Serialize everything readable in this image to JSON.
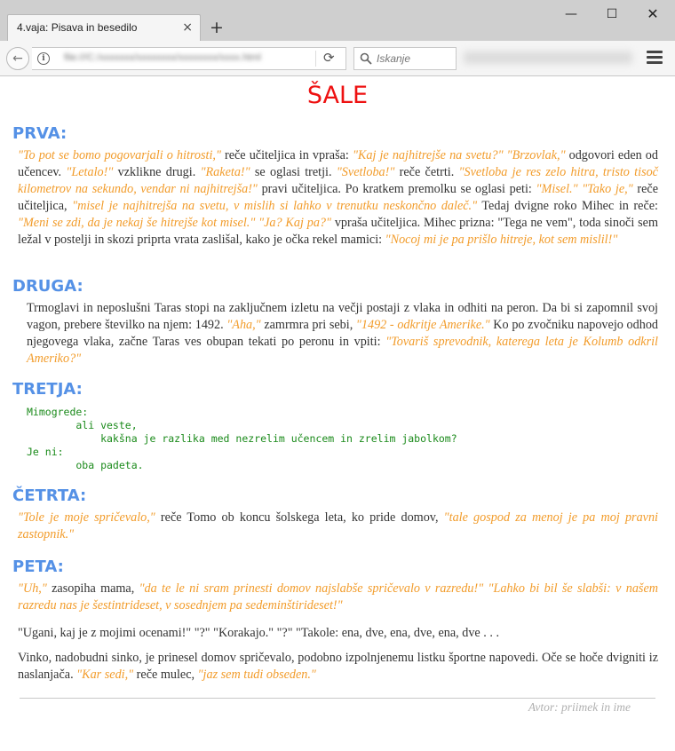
{
  "browser": {
    "tab_title": "4.vaja: Pisava in besedilo",
    "tab_close": "×",
    "new_tab": "+",
    "search_placeholder": "Iskanje",
    "window_controls": {
      "minimize": "—",
      "maximize": "☐",
      "close": "✕"
    },
    "icons": [
      "back-icon",
      "info-icon",
      "reload-icon",
      "search-icon",
      "menu-icon"
    ]
  },
  "page": {
    "title": "ŠALE",
    "sections": [
      {
        "heading": "PRVA:",
        "paragraph": [
          [
            "q",
            "\"To pot se bomo pogovarjali o hitrosti,\""
          ],
          [
            "t",
            " reče učiteljica in vpraša: "
          ],
          [
            "q",
            "\"Kaj je najhitrejše na svetu?\" \"Brzovlak,\""
          ],
          [
            "t",
            " odgovori eden od učencev. "
          ],
          [
            "q",
            "\"Letalo!\""
          ],
          [
            "t",
            " vzklikne drugi. "
          ],
          [
            "q",
            "\"Raketa!\""
          ],
          [
            "t",
            " se oglasi tretji. "
          ],
          [
            "q",
            "\"Svetloba!\""
          ],
          [
            "t",
            " reče četrti. "
          ],
          [
            "q",
            "\"Svetloba je res zelo hitra, tristo tisoč kilometrov na sekundo, vendar ni najhitrejša!\""
          ],
          [
            "t",
            " pravi učiteljica. Po kratkem premolku se oglasi peti: "
          ],
          [
            "q",
            "\"Misel.\" \"Tako je,\""
          ],
          [
            "t",
            " reče učiteljica, "
          ],
          [
            "q",
            "\"misel je najhitrejša na svetu, v mislih si lahko v trenutku neskončno daleč.\""
          ],
          [
            "t",
            " Tedaj dvigne roko Mihec in reče: "
          ],
          [
            "q",
            "\"Meni se zdi, da je nekaj še hitrejše kot misel.\" \"Ja? Kaj pa?\""
          ],
          [
            "t",
            " vpraša učiteljica. Mihec prizna: \"Tega ne vem\", toda sinoči sem ležal v postelji in skozi priprta vrata zaslišal, kako je očka rekel mamici: "
          ],
          [
            "q",
            "\"Nocoj mi je pa prišlo hitreje, kot sem mislil!\""
          ]
        ]
      },
      {
        "heading": "DRUGA:",
        "paragraph": [
          [
            "t",
            "Trmoglavi in neposlušni Taras stopi na zaključnem izletu na večji postaji z vlaka in odhiti na peron. Da bi si zapomnil svoj vagon, prebere številko na njem: 1492. "
          ],
          [
            "q",
            "\"Aha,\""
          ],
          [
            "t",
            " zamrmra pri sebi, "
          ],
          [
            "q",
            "\"1492 - odkritje Amerike.\""
          ],
          [
            "t",
            " Ko po zvočniku napovejo odhod njegovega vlaka, začne Taras ves obupan tekati po peronu in vpiti: "
          ],
          [
            "q",
            "\"Tovariš sprevodnik, katerega leta je Kolumb odkril Ameriko?\""
          ]
        ]
      },
      {
        "heading": "TRETJA:",
        "code": "Mimogrede:\n        ali veste,\n            kakšna je razlika med nezrelim učencem in zrelim jabolkom?\nJe ni:\n        oba padeta."
      },
      {
        "heading": "ČETRTA:",
        "paragraph": [
          [
            "q",
            "\"Tole je moje spričevalo,\""
          ],
          [
            "t",
            " reče Tomo ob koncu šolskega leta, ko pride domov, "
          ],
          [
            "q",
            "\"tale gospod za menoj je pa moj pravni zastopnik.\""
          ]
        ]
      },
      {
        "heading": "PETA:",
        "paragraphs": [
          [
            [
              "q",
              "\"Uh,\""
            ],
            [
              "t",
              " zasopiha mama, "
            ],
            [
              "q",
              "\"da te le ni sram prinesti domov najslabše spričevalo v razredu!\" \"Lahko bi bil še slabši: v našem razredu nas je šestintrideset, v sosednjem pa sedeminštirideset!\""
            ]
          ],
          [
            [
              "t",
              "\"Ugani, kaj je z mojimi ocenami!\" \"?\" \"Korakajo.\" \"?\" \"Takole: ena, dve, ena, dve, ena, dve . . ."
            ]
          ],
          [
            [
              "t",
              "Vinko, nadobudni sinko, je prinesel domov spričevalo, podobno izpolnjenemu listku športne napovedi. Oče se hoče dvigniti iz naslanjača. "
            ],
            [
              "q",
              "\"Kar sedi,\""
            ],
            [
              "t",
              " reče mulec, "
            ],
            [
              "q",
              "\"jaz sem tudi obseden.\""
            ]
          ]
        ]
      }
    ],
    "author": "Avtor: priimek in ime"
  }
}
